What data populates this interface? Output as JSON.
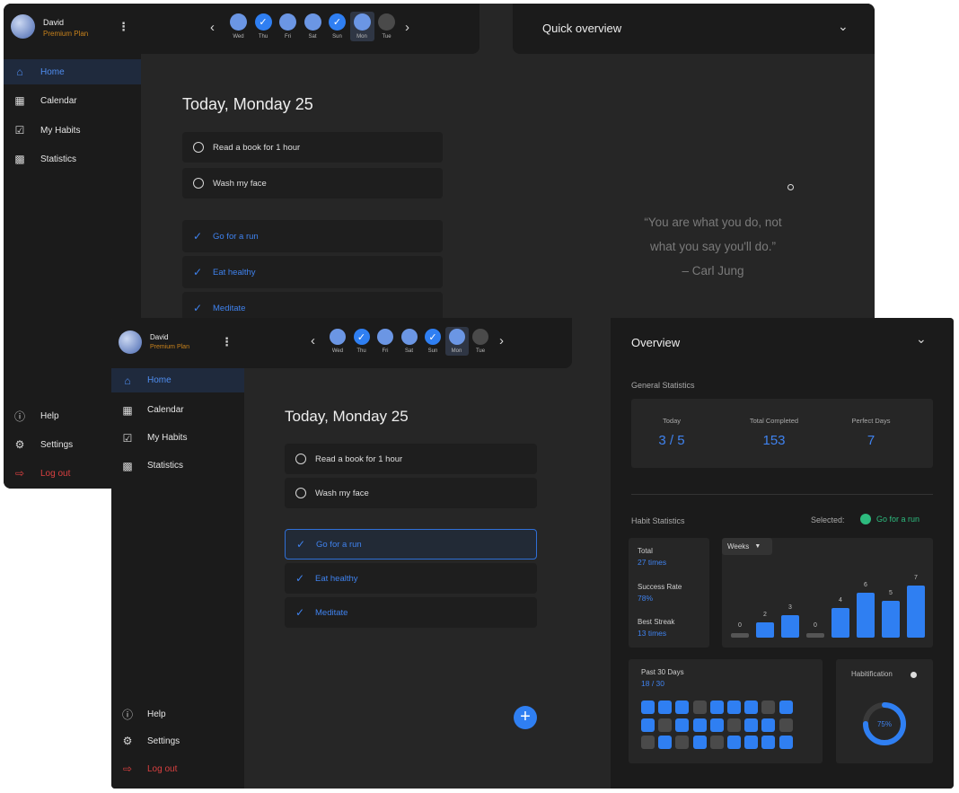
{
  "user": {
    "name": "David",
    "plan": "Premium Plan"
  },
  "days": [
    {
      "label": "Wed",
      "state": "todo"
    },
    {
      "label": "Thu",
      "state": "done"
    },
    {
      "label": "Fri",
      "state": "todo"
    },
    {
      "label": "Sat",
      "state": "todo"
    },
    {
      "label": "Sun",
      "state": "done"
    },
    {
      "label": "Mon",
      "state": "selected"
    },
    {
      "label": "Tue",
      "state": "off"
    }
  ],
  "nav": {
    "home": "Home",
    "calendar": "Calendar",
    "habits": "My Habits",
    "statistics": "Statistics",
    "help": "Help",
    "settings": "Settings",
    "logout": "Log out"
  },
  "main": {
    "heading": "Today, Monday 25",
    "pending": [
      "Read a book for 1 hour",
      "Wash my face"
    ],
    "completed": [
      "Go for a run",
      "Eat healthy",
      "Meditate"
    ]
  },
  "back_panel": {
    "title": "Quick overview",
    "quote_line1": "“You are what you do, not",
    "quote_line2": "what you say you'll do.”",
    "quote_author": "– Carl Jung"
  },
  "overview": {
    "title": "Overview",
    "general_label": "General Statistics",
    "today_label": "Today",
    "today_value": "3 / 5",
    "total_label": "Total Completed",
    "total_value": "153",
    "perfect_label": "Perfect Days",
    "perfect_value": "7",
    "habit_label": "Habit Statistics",
    "selected_label": "Selected:",
    "selected_habit": "Go for a run",
    "h_total_label": "Total",
    "h_total_value": "27 times",
    "h_rate_label": "Success Rate",
    "h_rate_value": "78%",
    "h_streak_label": "Best Streak",
    "h_streak_value": "13 times",
    "weeks_label": "Weeks",
    "past_label": "Past 30 Days",
    "past_value": "18 / 30",
    "habitification_label": "Habitification",
    "habitification_value": "75%",
    "habitification_fraction": 0.75
  },
  "chart_data": {
    "type": "bar",
    "values": [
      0,
      2,
      3,
      0,
      4,
      6,
      5,
      7
    ]
  },
  "past30": [
    1,
    1,
    1,
    0,
    1,
    1,
    1,
    0,
    1,
    1,
    0,
    1,
    1,
    1,
    0,
    1,
    1,
    0,
    0,
    1,
    0,
    1,
    0,
    1,
    1,
    1,
    1
  ],
  "colors": {
    "accent": "#2f7ff2",
    "warning": "#c8821c",
    "danger": "#d94040",
    "success": "#2dbb7e"
  }
}
